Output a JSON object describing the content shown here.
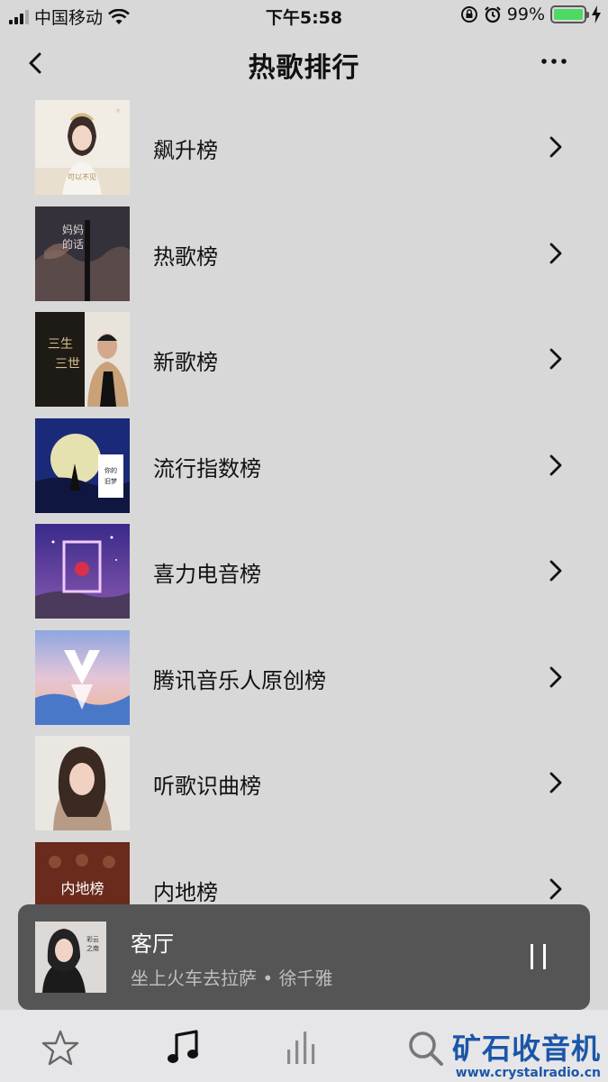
{
  "status_bar": {
    "carrier": "中国移动",
    "time": "下午5:58",
    "battery": "99%",
    "battery_level": 0.99,
    "icons": [
      "signal-icon",
      "wifi-icon",
      "orientation-lock-icon",
      "alarm-icon",
      "battery-icon",
      "charging-icon"
    ]
  },
  "nav": {
    "title": "热歌排行",
    "back_icon": "chevron-left-icon",
    "more_icon": "ellipsis-icon"
  },
  "charts": [
    {
      "label": "飙升榜"
    },
    {
      "label": "热歌榜"
    },
    {
      "label": "新歌榜"
    },
    {
      "label": "流行指数榜"
    },
    {
      "label": "喜力电音榜"
    },
    {
      "label": "腾讯音乐人原创榜"
    },
    {
      "label": "听歌识曲榜"
    },
    {
      "label": "内地榜",
      "cover_text": "内地榜"
    }
  ],
  "player": {
    "song": "客厅",
    "subtitle": "坐上火车去拉萨 • 徐千雅",
    "pause_icon": "pause-icon"
  },
  "tabbar": {
    "tabs": [
      "star-icon",
      "music-note-icon",
      "bars-icon",
      "search-icon"
    ],
    "active": "music-note-icon"
  },
  "watermark": {
    "main": "矿石收音机",
    "url": "www.crystalradio.cn"
  },
  "colors": {
    "background": "#d8d8d8",
    "player_bg": "#555556",
    "battery_green": "#4cd964",
    "watermark_blue": "#1b56a8"
  }
}
